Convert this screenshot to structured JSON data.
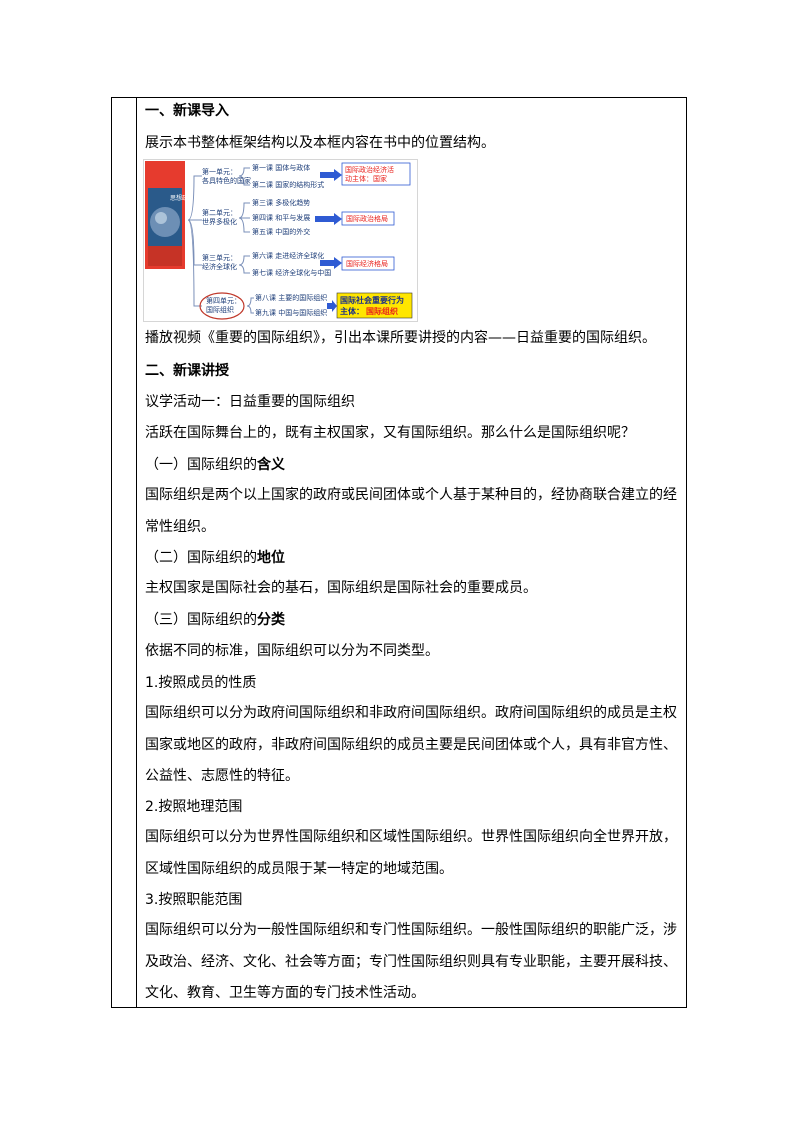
{
  "section1": {
    "heading": "一、新课导入",
    "intro": "展示本书整体框架结构以及本框内容在书中的位置结构。",
    "video": "播放视频《重要的国际组织》，引出本课所要讲授的内容——日益重要的国际组织。"
  },
  "figure": {
    "book_title": "思想政治",
    "units": [
      {
        "name_line1": "第一单元：",
        "name_line2": "各具特色的国家",
        "lessons": [
          "第一课  国体与政体",
          "第二课  国家的结构形式"
        ],
        "result_line1": "国际政治经济活",
        "result_line2": "动主体：",
        "result_highlight": "国家"
      },
      {
        "name_line1": "第二单元：",
        "name_line2": "世界多极化",
        "lessons": [
          "第三课  多极化趋势",
          "第四课  和平与发展",
          "第五课  中国的外交"
        ],
        "result_line1": "国际政治格局"
      },
      {
        "name_line1": "第三单元：",
        "name_line2": "经济全球化",
        "lessons": [
          "第六课  走进经济全球化",
          "第七课  经济全球化与中国"
        ],
        "result_line1": "国际经济格局"
      },
      {
        "name_line1": "第四单元：",
        "name_line2": "国际组织",
        "lessons": [
          "第八课  主要的国际组织",
          "第九课  中国与国际组织"
        ],
        "result_line1": "国际社会重要行为",
        "result_line2": "主体：",
        "result_highlight": "国际组织"
      }
    ],
    "colors": {
      "accent_red": "#e8211c",
      "arrow_blue": "#2f5bd3",
      "highlight_yellow": "#ffe600",
      "oval_red": "#c0392b"
    }
  },
  "section2": {
    "heading": "二、新课讲授",
    "activity": "议学活动一：日益重要的国际组织",
    "question": "活跃在国际舞台上的，既有主权国家，又有国际组织。那么什么是国际组织呢？",
    "sub1_title_prefix": "（一）国际组织的",
    "sub1_title_bold": "含义",
    "sub1_text": "国际组织是两个以上国家的政府或民间团体或个人基于某种目的，经协商联合建立的经常性组织。",
    "sub2_title_prefix": "（二）国际组织的",
    "sub2_title_bold": "地位",
    "sub2_text": "主权国家是国际社会的基石，国际组织是国际社会的重要成员。",
    "sub3_title_prefix": "（三）国际组织的",
    "sub3_title_bold": "分类",
    "sub3_text": "依据不同的标准，国际组织可以分为不同类型。",
    "c1_title": "1.按照成员的性质",
    "c1_text": "国际组织可以分为政府间国际组织和非政府间国际组织。政府间国际组织的成员是主权国家或地区的政府，非政府间国际组织的成员主要是民间团体或个人，具有非官方性、公益性、志愿性的特征。",
    "c2_title": "2.按照地理范围",
    "c2_text": "国际组织可以分为世界性国际组织和区域性国际组织。世界性国际组织向全世界开放，区域性国际组织的成员限于某一特定的地域范围。",
    "c3_title": "3.按照职能范围",
    "c3_text": "国际组织可以分为一般性国际组织和专门性国际组织。一般性国际组织的职能广泛，涉及政治、经济、文化、社会等方面；专门性国际组织则具有专业职能，主要开展科技、文化、教育、卫生等方面的专门技术性活动。"
  }
}
